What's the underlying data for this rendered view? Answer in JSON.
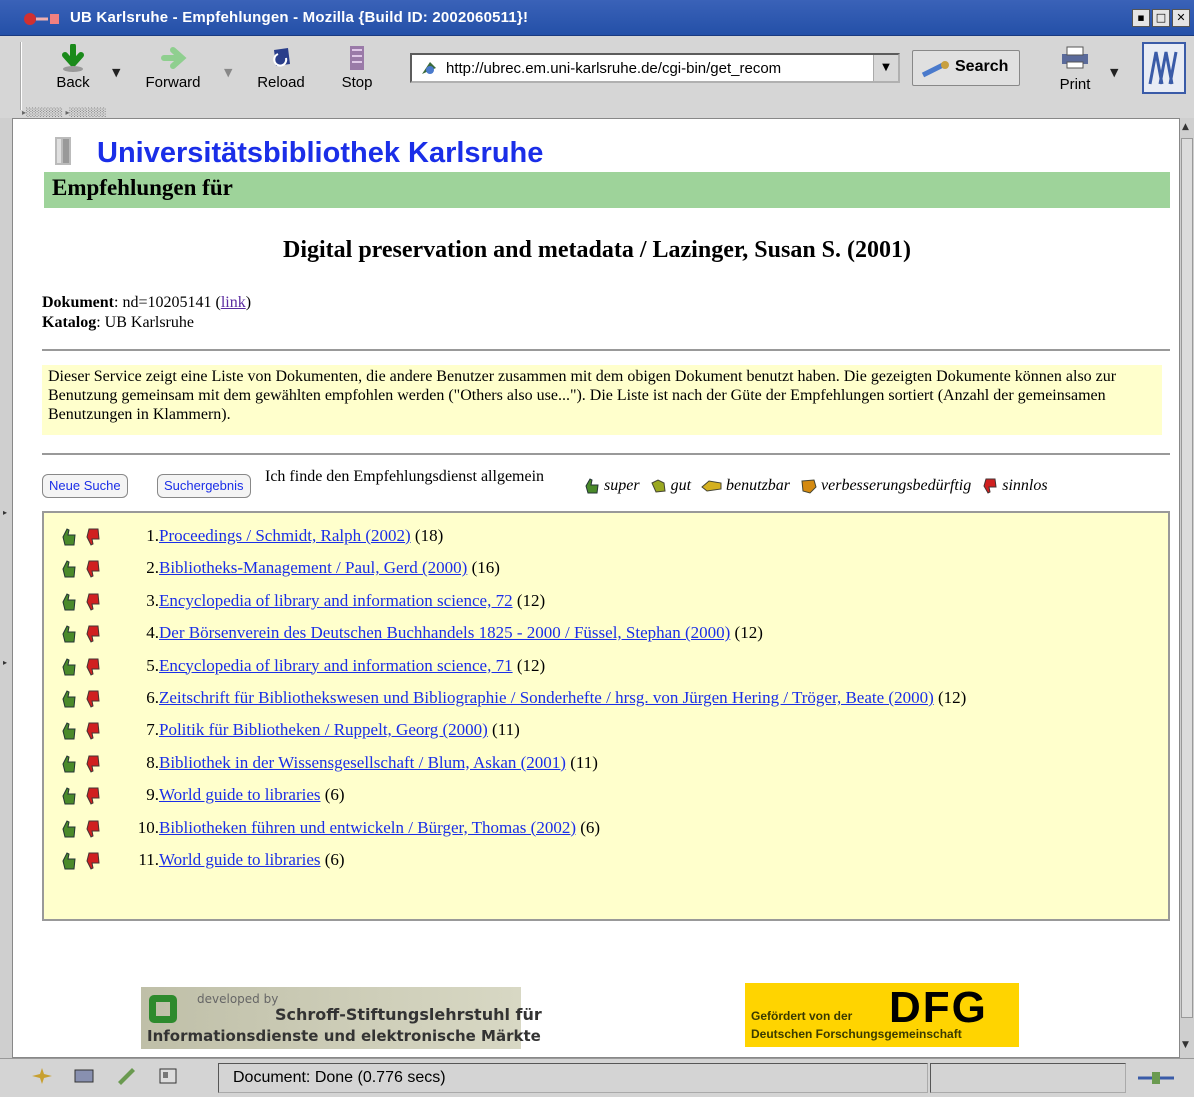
{
  "window": {
    "title": "UB Karlsruhe - Empfehlungen - Mozilla {Build ID: 2002060511}!"
  },
  "toolbar": {
    "back_label": "Back",
    "forward_label": "Forward",
    "reload_label": "Reload",
    "stop_label": "Stop",
    "url": "http://ubrec.em.uni-karlsruhe.de/cgi-bin/get_recom",
    "search_label": "Search",
    "print_label": "Print"
  },
  "page": {
    "header_title": "Universitätsbibliothek Karlsruhe",
    "section_title": "Empfehlungen für",
    "doc_title": "Digital preservation and metadata / Lazinger, Susan S. (2001)",
    "dokument_label": "Dokument",
    "dokument_value": ": nd=10205141 (",
    "link_label": "link",
    "katalog_label": "Katalog",
    "katalog_value": ": UB Karlsruhe",
    "info_text": "Dieser Service zeigt eine Liste von Dokumenten, die andere Benutzer zusammen mit dem obigen Dokument benutzt haben. Die gezeigten Dokumente können also zur Benutzung gemeinsam mit dem gewählten empfohlen werden (\"Others also use...\"). Die Liste ist nach der Güte der Empfehlungen sortiert (Anzahl der gemeinsamen Benutzungen in Klammern).",
    "neue_suche": "Neue Suche",
    "suchergebnis": "Suchergebnis",
    "find_text": "Ich finde den Empfehlungsdienst allgemein",
    "legend": [
      "super",
      "gut",
      "benutzbar",
      "verbesserungsbedürftig",
      "sinnlos"
    ],
    "recommendations": [
      {
        "num": "1.",
        "title": "Proceedings / Schmidt, Ralph (2002)",
        "count": "(18)"
      },
      {
        "num": "2.",
        "title": "Bibliotheks-Management / Paul, Gerd (2000)",
        "count": "(16)"
      },
      {
        "num": "3.",
        "title": "Encyclopedia of library and information science, 72",
        "count": "(12)"
      },
      {
        "num": "4.",
        "title": "Der Börsenverein des Deutschen Buchhandels 1825 - 2000 / Füssel, Stephan (2000)",
        "count": "(12)"
      },
      {
        "num": "5.",
        "title": "Encyclopedia of library and information science, 71",
        "count": "(12)"
      },
      {
        "num": "6.",
        "title": "Zeitschrift für Bibliothekswesen und Bibliographie / Sonderhefte / hrsg. von Jürgen Hering / Tröger, Beate (2000)",
        "count": "(12)"
      },
      {
        "num": "7.",
        "title": "Politik für Bibliotheken / Ruppelt, Georg (2000)",
        "count": "(11)"
      },
      {
        "num": "8.",
        "title": "Bibliothek in der Wissensgesellschaft / Blum, Askan (2001)",
        "count": "(11)"
      },
      {
        "num": "9.",
        "title": "World guide to libraries",
        "count": "(6)"
      },
      {
        "num": "10.",
        "title": "Bibliotheken führen und entwickeln / Bürger, Thomas (2002)",
        "count": "(6)"
      },
      {
        "num": "11.",
        "title": "World guide to libraries",
        "count": "(6)"
      }
    ],
    "sponsor1": {
      "developed_by": "developed by",
      "line1": "Schroff-Stiftungslehrstuhl für",
      "line2": "Informationsdienste und elektronische Märkte"
    },
    "sponsor2": {
      "line1": "Gefördert von der",
      "logo": "DFG",
      "line2": "Deutschen Forschungsgemeinschaft"
    }
  },
  "statusbar": {
    "status": "Document: Done (0.776 secs)"
  },
  "colors": {
    "link": "#1a2ee8",
    "green_bar": "#9ed39a",
    "info_bg": "#ffffcc"
  }
}
